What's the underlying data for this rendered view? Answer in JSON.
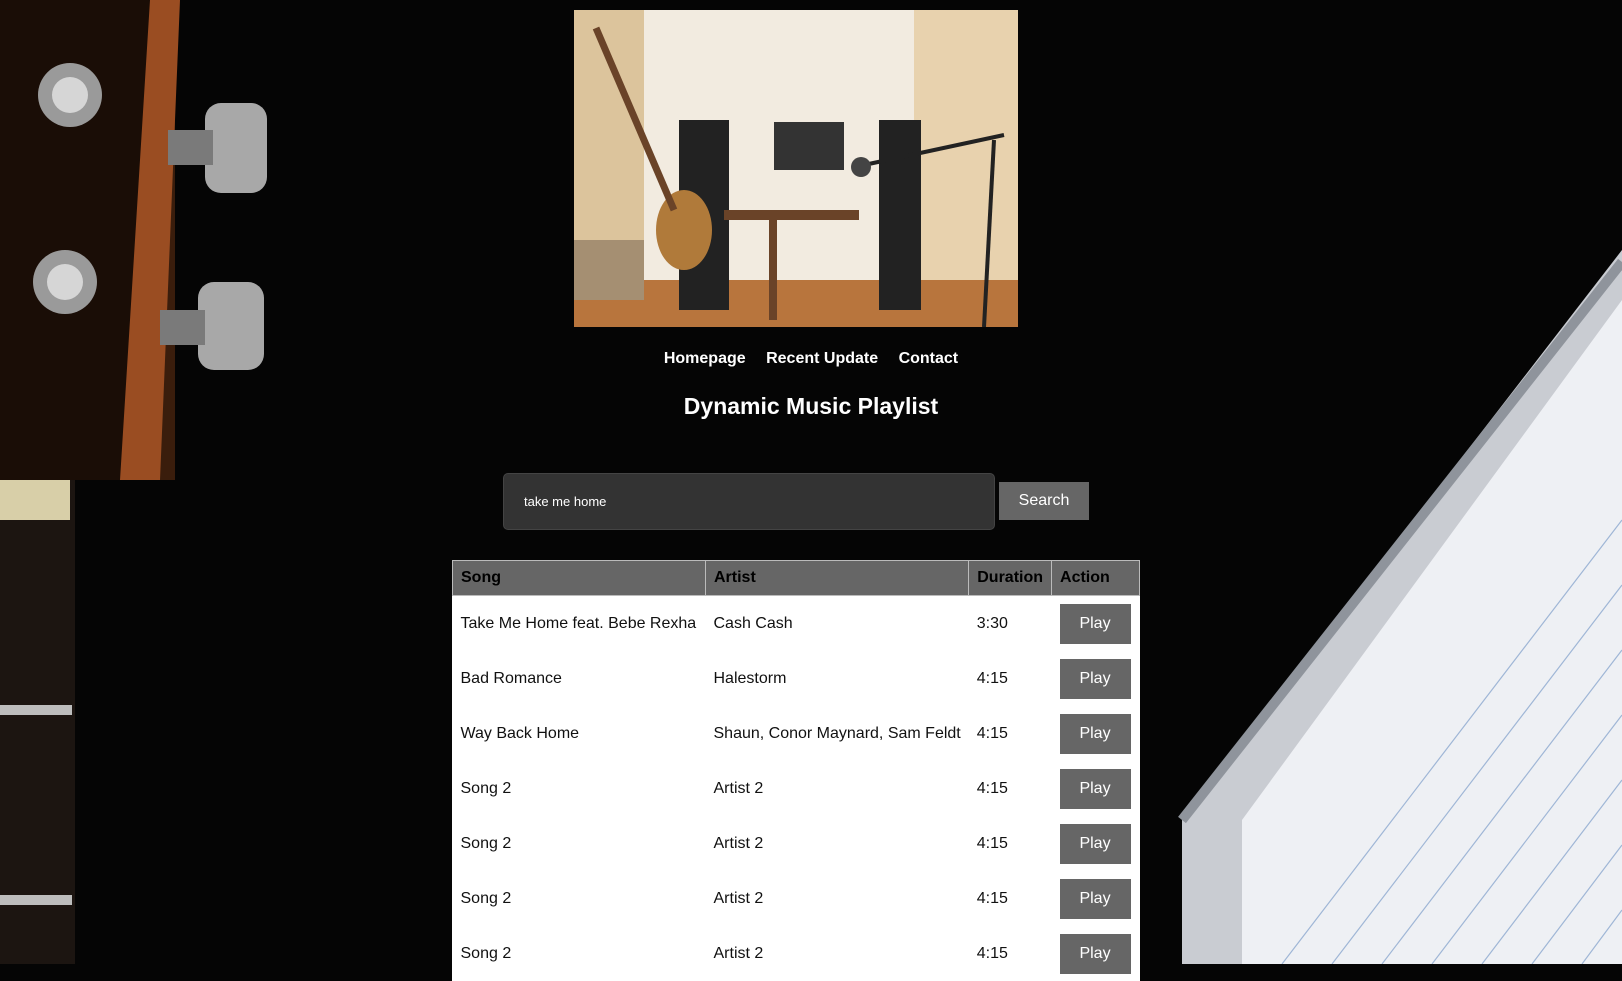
{
  "nav": [
    "Homepage",
    "Recent Update",
    "Contact"
  ],
  "page_title": "Dynamic Music Playlist",
  "search": {
    "value": "take me home",
    "button_label": "Search"
  },
  "table": {
    "headers": [
      "Song",
      "Artist",
      "Duration",
      "Action"
    ],
    "rows": [
      {
        "song": "Take Me Home feat. Bebe Rexha",
        "artist": "Cash Cash",
        "duration": "3:30",
        "action": "Play"
      },
      {
        "song": "Bad Romance",
        "artist": "Halestorm",
        "duration": "4:15",
        "action": "Play"
      },
      {
        "song": "Way Back Home",
        "artist": "Shaun, Conor Maynard, Sam Feldt",
        "duration": "4:15",
        "action": "Play"
      },
      {
        "song": "Song 2",
        "artist": "Artist 2",
        "duration": "4:15",
        "action": "Play"
      },
      {
        "song": "Song 2",
        "artist": "Artist 2",
        "duration": "4:15",
        "action": "Play"
      },
      {
        "song": "Song 2",
        "artist": "Artist 2",
        "duration": "4:15",
        "action": "Play"
      },
      {
        "song": "Song 2",
        "artist": "Artist 2",
        "duration": "4:15",
        "action": "Play"
      }
    ]
  }
}
